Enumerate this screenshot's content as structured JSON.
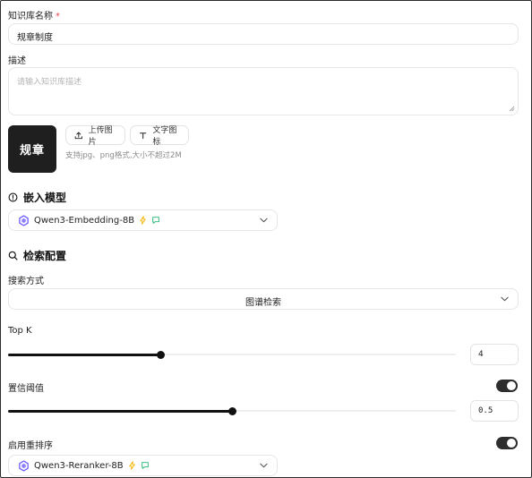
{
  "form": {
    "name_label": "知识库名称",
    "required_mark": "*",
    "name_value": "规章制度",
    "desc_label": "描述",
    "desc_placeholder": "请输入知识库描述",
    "logo_text": "规章",
    "upload_button": "上传图片",
    "text_icon_button": "文字图标",
    "upload_hint": "支持jpg、png格式,大小不超过2M"
  },
  "embedding": {
    "title": "嵌入模型",
    "model_name": "Qwen3-Embedding-8B"
  },
  "retrieval": {
    "title": "检索配置",
    "search_mode_label": "搜索方式",
    "search_mode_value": "图谱检索",
    "topk_label": "Top K",
    "topk_value": "4",
    "topk_fraction": 0.34,
    "threshold_label": "置信阈值",
    "threshold_value": "0.5",
    "threshold_fraction": 0.5,
    "threshold_enabled": true,
    "rerank_label": "启用重排序",
    "rerank_enabled": true,
    "rerank_model": "Qwen3-Reranker-8B"
  },
  "colors": {
    "accent": "#111111",
    "required": "#e5484d",
    "badge_lightning": "#f5b400",
    "badge_chat": "#22b573",
    "model_logo": "#6b5cff"
  },
  "icons": {
    "upload": "upload-icon",
    "text": "text-t-icon",
    "info": "info-circle-icon",
    "search": "search-icon",
    "chevron": "chevron-down-icon",
    "lightning": "lightning-icon",
    "chat": "chat-bubble-icon",
    "model": "qwen-logo-icon"
  }
}
